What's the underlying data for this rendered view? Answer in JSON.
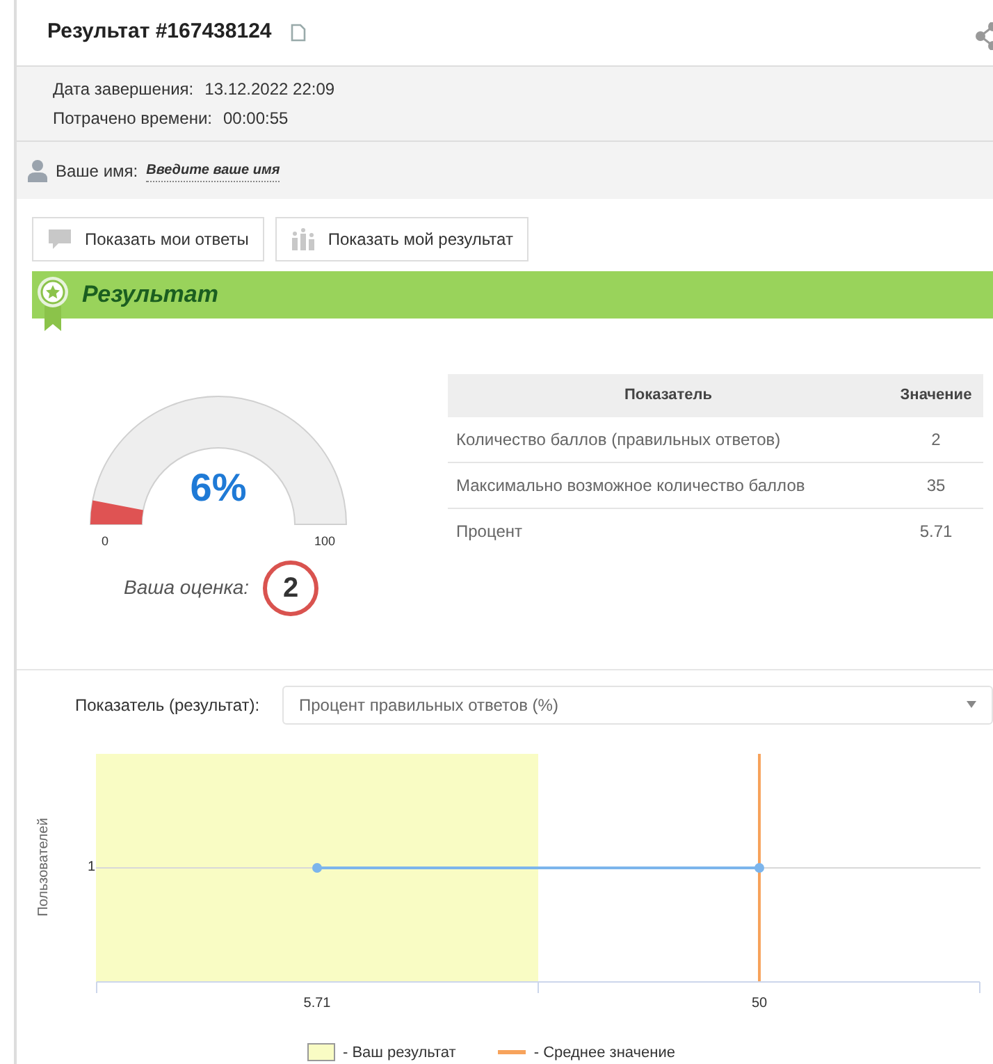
{
  "header": {
    "title": "Результат #167438124"
  },
  "info": [
    {
      "label": "Дата завершения:",
      "value": "13.12.2022 22:09"
    },
    {
      "label": "Потрачено времени:",
      "value": "00:00:55"
    }
  ],
  "name_row": {
    "label": "Ваше имя:",
    "link": "Введите ваше имя"
  },
  "buttons": [
    {
      "label": "Показать мои ответы",
      "kind": "answers"
    },
    {
      "label": "Показать мой результат",
      "kind": "result"
    }
  ],
  "banner": {
    "title": "Результат"
  },
  "gauge": {
    "level": 0.06,
    "reading": "6%",
    "min": "0",
    "max": "100"
  },
  "grade": {
    "label": "Ваша оценка:",
    "value": "2"
  },
  "table": {
    "columns": [
      "Показатель",
      "Значение"
    ],
    "rows": [
      [
        "Количество баллов (правильных ответов)",
        "2"
      ],
      [
        "Максимально возможное количество баллов",
        "35"
      ],
      [
        "Процент",
        "5.71"
      ]
    ]
  },
  "selector": {
    "label": "Показатель (результат):",
    "value": "Процент правильных ответов (%)"
  },
  "chart": {
    "ylabel": "Пользователей",
    "x_labels": [
      "5.71",
      "50"
    ],
    "y_tick": "1"
  },
  "legend": [
    {
      "label": "- Ваш результат",
      "kind": "swatch",
      "color": "#f9fcc4"
    },
    {
      "label": "- Среднее значение",
      "kind": "line",
      "color": "#f7a35c"
    }
  ]
}
